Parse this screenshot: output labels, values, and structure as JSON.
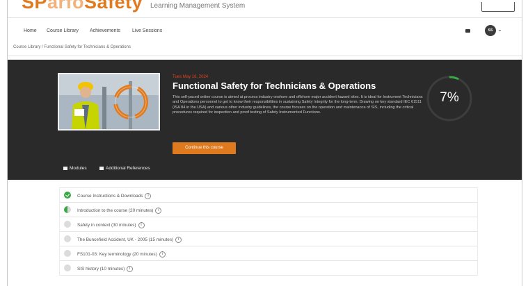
{
  "brand": {
    "part1": "SP",
    "part2": "arfo",
    "part3": "Safety",
    "tagline": "Learning Management System"
  },
  "nav": {
    "items": [
      "Home",
      "Course Library",
      "Achievements",
      "Live Sessions"
    ],
    "avatar_initials": "SS"
  },
  "breadcrumb": "Course Library  /  Functional Safety for Technicians & Operations",
  "course": {
    "dates": "Tues May 16, 2024",
    "title": "Functional Safety for Technicians & Operations",
    "description": "This self-paced online course is aimed at process industry onshore and offshore major accident hazard sites. It is ideal for Instrument Technicians and Operations personnel to get to know their responsibilities in sustaining Safety Integrity for the long-term. Drawing on key standard IEC 61511 (ISA 84 in the USA) and various other industry guidelines, the course focuses on the operation and maintenance of SIS, including the critical procedures required for inspection and proof testing of Safety Instrumented Functions.",
    "cta_label": "Continue this course",
    "progress_pct": 7,
    "progress_text": "7%"
  },
  "tabs": [
    "Modules",
    "Additional References"
  ],
  "modules": [
    {
      "label": "Course Instructions & Downloads",
      "status": "done"
    },
    {
      "label": "Introduction to the course (20 minutes)",
      "status": "half"
    },
    {
      "label": "Safety in context (30 minutes)",
      "status": "todo"
    },
    {
      "label": "The Buncefield Accident, UK - 2005 (15 minutes)",
      "status": "todo"
    },
    {
      "label": "FS101-03: Key terminology (20 minutes)",
      "status": "todo"
    },
    {
      "label": "SIS history (10 minutes)",
      "status": "todo"
    }
  ],
  "colors": {
    "accent": "#e07a1f",
    "hero_bg": "#2a2a2a",
    "done": "#3aa845",
    "progress": "#3aa845"
  },
  "icons": {
    "mail": "envelope-icon",
    "info": "info-icon",
    "chevron": "chevron-down-icon"
  }
}
